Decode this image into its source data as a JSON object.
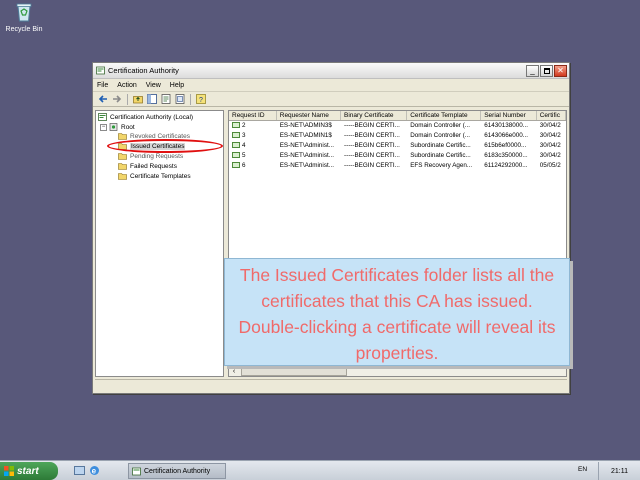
{
  "desktop": {
    "recycle_bin_label": "Recycle Bin"
  },
  "window": {
    "title": "Certification Authority",
    "icon": "certification-authority-icon",
    "menu": [
      "File",
      "Action",
      "View",
      "Help"
    ],
    "controls": {
      "minimize": "minimize-icon",
      "maximize": "maximize-icon",
      "close": "close-icon"
    },
    "toolbar_icons": [
      "back-arrow-icon",
      "forward-arrow-icon",
      "up-folder-icon",
      "console-tree-icon",
      "export-list-icon",
      "properties-icon",
      "help-icon"
    ]
  },
  "tree": {
    "root_label": "Certification Authority (Local)",
    "ca_label": "Root",
    "items": [
      "Revoked Certificates",
      "Issued Certificates",
      "Pending Requests",
      "Failed Requests",
      "Certificate Templates"
    ],
    "selected": "Issued Certificates"
  },
  "list": {
    "columns": [
      "Request ID",
      "Requester Name",
      "Binary Certificate",
      "Certificate Template",
      "Serial Number",
      "Certific"
    ],
    "rows": [
      [
        "2",
        "ES-NET\\ADMIN3$",
        "-----BEGIN CERTI...",
        "Domain Controller (...",
        "61430138000...",
        "30/04/2"
      ],
      [
        "3",
        "ES-NET\\ADMIN1$",
        "-----BEGIN CERTI...",
        "Domain Controller (...",
        "6143066e000...",
        "30/04/2"
      ],
      [
        "4",
        "ES-NET\\Administ...",
        "-----BEGIN CERTI...",
        "Subordinate Certific...",
        "615b6ef0000...",
        "30/04/2"
      ],
      [
        "5",
        "ES-NET\\Administ...",
        "-----BEGIN CERTI...",
        "Subordinate Certific...",
        "6183c350000...",
        "30/04/2"
      ],
      [
        "6",
        "ES-NET\\Administ...",
        "-----BEGIN CERTI...",
        "EFS Recovery Agen...",
        "61124292000...",
        "05/05/2"
      ]
    ]
  },
  "caption": "The Issued Certificates folder lists all the certificates that this CA has issued. Double-clicking a certificate will reveal its properties.",
  "taskbar": {
    "start_label": "start",
    "task_label": "Certification Authority",
    "language": "EN",
    "clock": "21:11"
  },
  "colors": {
    "desktop": "#58587a",
    "caption_text": "#f06a6a",
    "caption_bg": "#c6e3f7",
    "highlight_ring": "#e01010"
  }
}
